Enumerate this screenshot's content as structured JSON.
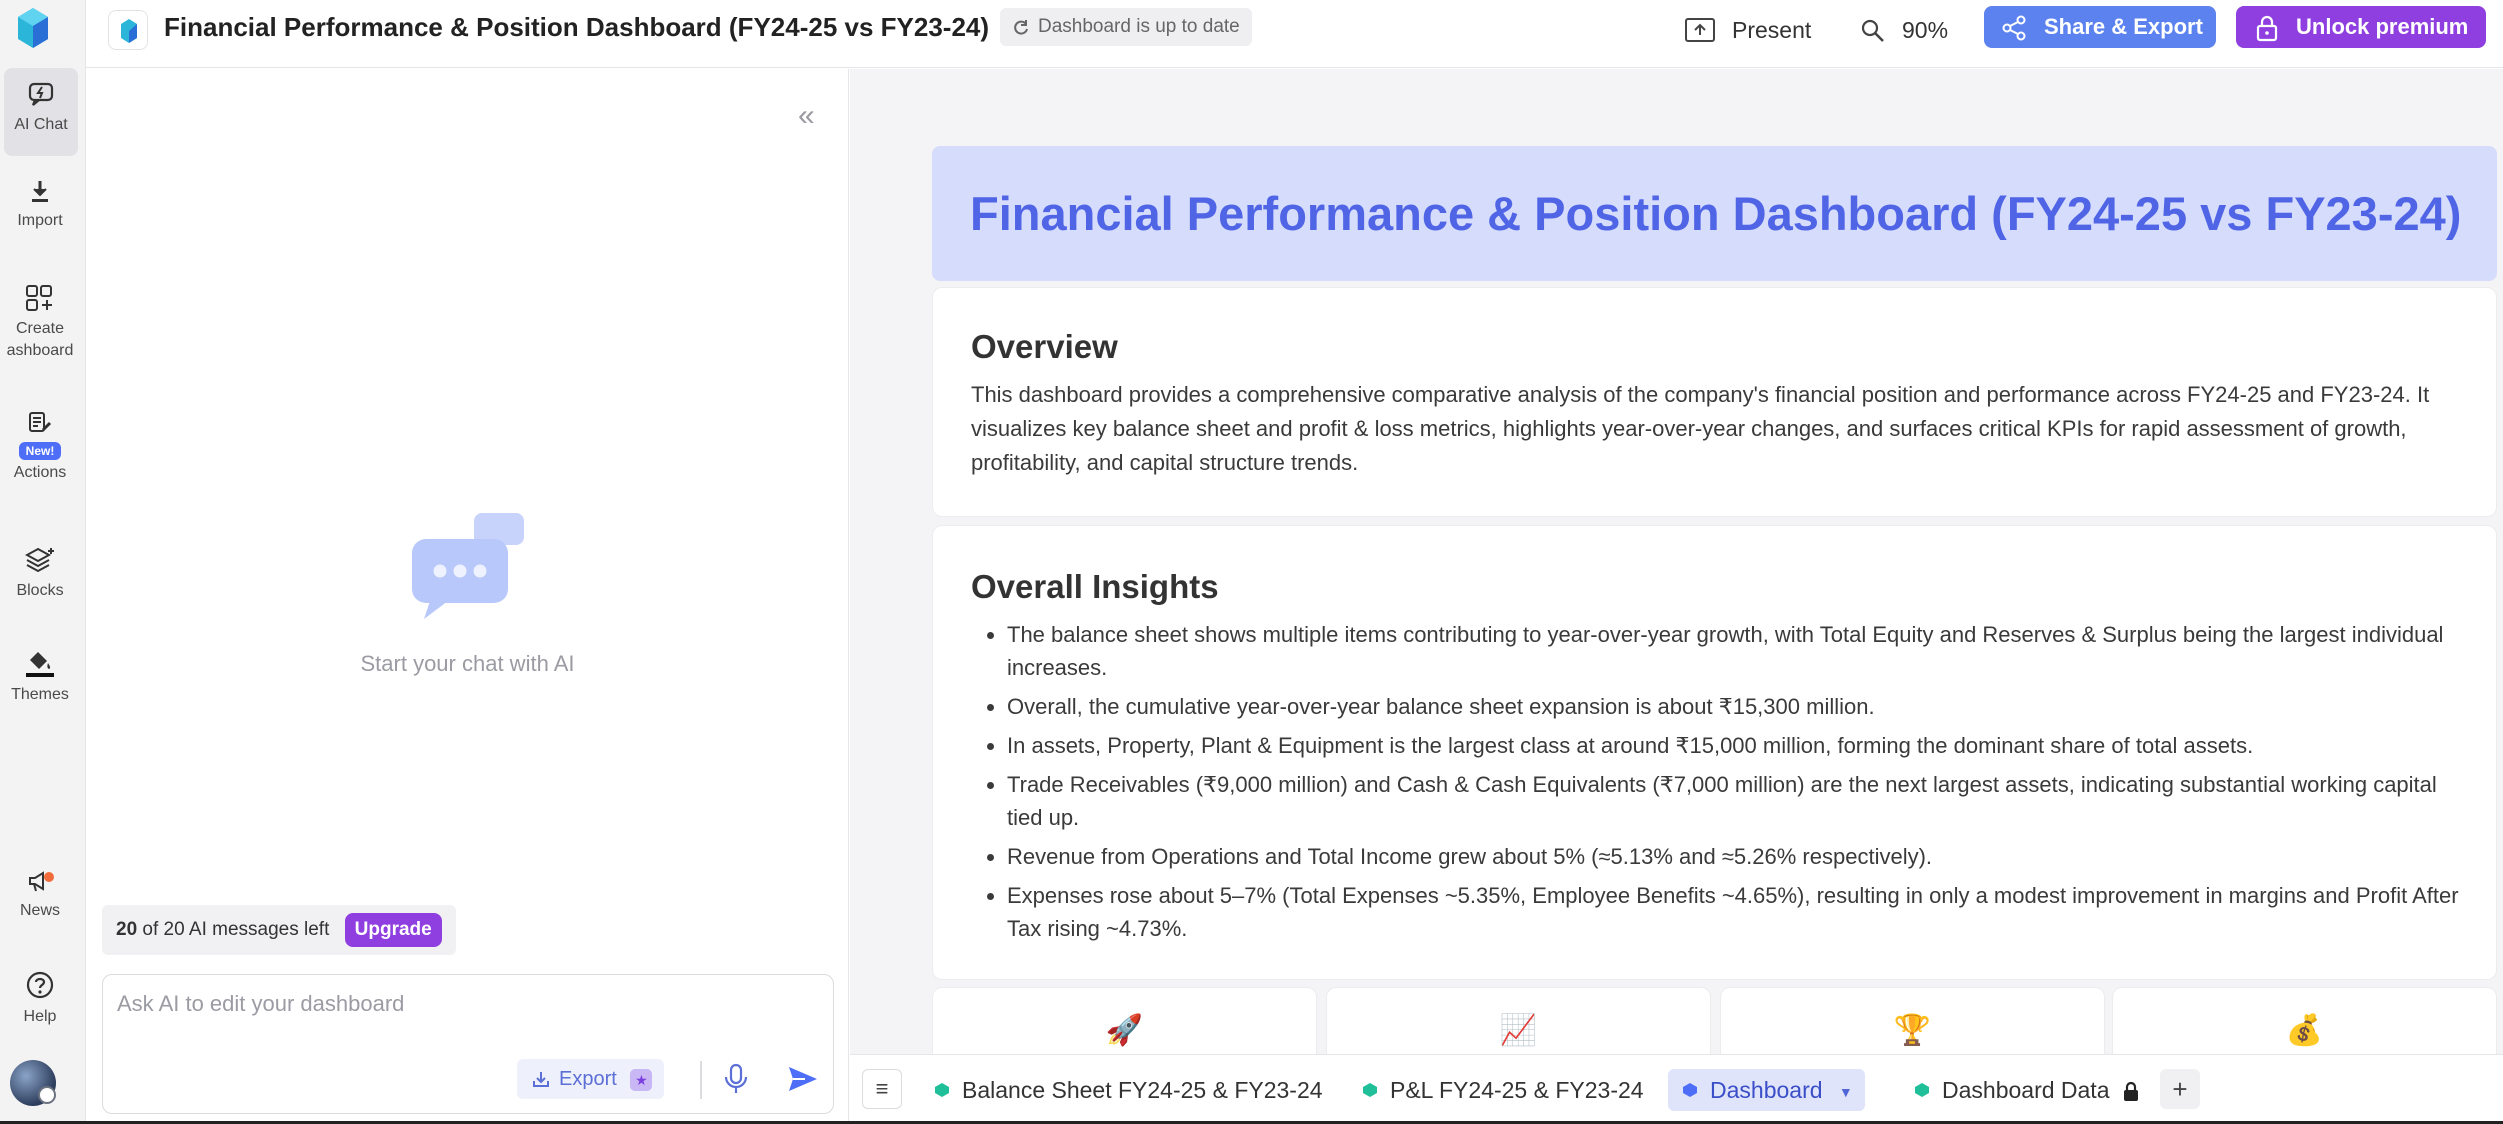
{
  "header": {
    "title": "Financial Performance & Position Dashboard (FY24-25 vs FY23-24)",
    "status": "Dashboard is up to date",
    "present_label": "Present",
    "zoom": "90%",
    "share_label": "Share & Export",
    "premium_label": "Unlock premium"
  },
  "rail": {
    "items": [
      {
        "label": "AI Chat",
        "icon": "ai-chat-icon"
      },
      {
        "label": "Import",
        "icon": "download-icon"
      },
      {
        "label": "Create\nashboard",
        "icon": "create-dashboard-icon"
      },
      {
        "label": "Actions",
        "icon": "actions-icon",
        "badge": "New!"
      },
      {
        "label": "Blocks",
        "icon": "layers-icon"
      },
      {
        "label": "Themes",
        "icon": "paint-bucket-icon"
      },
      {
        "label": "News",
        "icon": "megaphone-icon"
      },
      {
        "label": "Help",
        "icon": "help-icon"
      }
    ]
  },
  "chat": {
    "empty_text": "Start your chat with AI",
    "quota_count": "20",
    "quota_text": "of 20 AI messages left",
    "upgrade_label": "Upgrade",
    "input_placeholder": "Ask AI to edit your dashboard",
    "export_label": "Export"
  },
  "main": {
    "banner_title": "Financial Performance & Position Dashboard (FY24-25 vs FY23-24)",
    "overview": {
      "heading": "Overview",
      "text": "This dashboard provides a comprehensive comparative analysis of the company's financial position and performance across FY24-25 and FY23-24. It visualizes key balance sheet and profit & loss metrics, highlights year-over-year changes, and surfaces critical KPIs for rapid assessment of growth, profitability, and capital structure trends."
    },
    "insights": {
      "heading": "Overall Insights",
      "items": [
        "The balance sheet shows multiple items contributing to year-over-year growth, with Total Equity and Reserves & Surplus being the largest individual increases.",
        "Overall, the cumulative year-over-year balance sheet expansion is about ₹15,300 million.",
        "In assets, Property, Plant & Equipment is the largest class at around ₹15,000 million, forming the dominant share of total assets.",
        "Trade Receivables (₹9,000 million) and Cash & Cash Equivalents (₹7,000 million) are the next largest assets, indicating substantial working capital tied up.",
        "Revenue from Operations and Total Income grew about 5% (≈5.13% and ≈5.26% respectively).",
        "Expenses rose about 5–7% (Total Expenses ~5.35%, Employee Benefits ~4.65%), resulting in only a modest improvement in margins and Profit After Tax rising ~4.73%."
      ]
    },
    "kpi_emojis": [
      "🚀",
      "📈",
      "🏆",
      "💰"
    ]
  },
  "tabs": [
    {
      "label": "Balance Sheet FY24-25 & FY23-24",
      "color": "#1fbf9a"
    },
    {
      "label": "P&L FY24-25 & FY23-24",
      "color": "#1fbf9a"
    },
    {
      "label": "Dashboard",
      "color": "#4f6ef7",
      "active": true
    },
    {
      "label": "Dashboard Data",
      "color": "#1fbf9a",
      "locked": true
    }
  ],
  "colors": {
    "accent_blue": "#5b82ee",
    "premium_purple": "#8f3fe0",
    "banner_bg": "#d6dcfb",
    "banner_text": "#5065e6"
  }
}
